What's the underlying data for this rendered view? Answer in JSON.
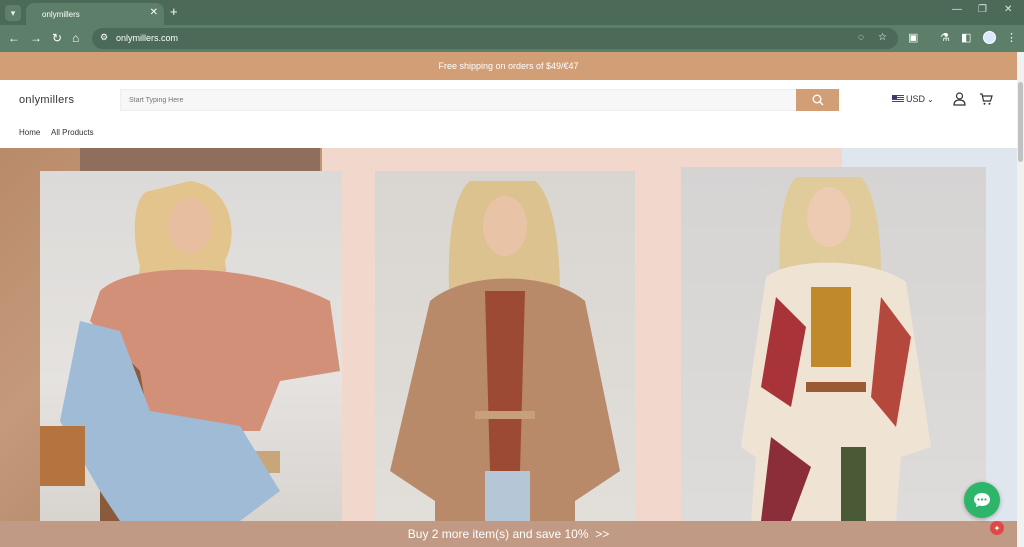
{
  "browser": {
    "tab_title": "onlymillers",
    "tab_close": "✕",
    "new_tab": "+",
    "url": "onlymillers.com",
    "icons": [
      "tab-search-icon",
      "back-icon",
      "forward-icon",
      "reload-icon",
      "home-icon",
      "site-info-icon",
      "eye-off-icon",
      "star-icon",
      "extensions-icon",
      "labs-icon",
      "sidebar-icon",
      "profile-icon",
      "menu-icon",
      "minimize-icon",
      "restore-icon",
      "close-icon"
    ]
  },
  "announcement": {
    "text": "Free shipping on orders of $49/€47"
  },
  "header": {
    "logo": "onlymillers",
    "search_placeholder": "Start Typing Here",
    "currency": "USD",
    "icons": [
      "search-icon",
      "flag-icon",
      "chevron-down-icon",
      "account-icon",
      "cart-icon"
    ]
  },
  "nav": [
    {
      "label": "Home"
    },
    {
      "label": "All Products"
    }
  ],
  "hero": {
    "images": [
      "model-in-peach-lace-blouse",
      "model-in-paisley-quilted-jacket",
      "model-in-floral-cardigan"
    ]
  },
  "promo_bar": {
    "text": "Buy 2 more item(s) and save 10%  >>"
  },
  "widgets": {
    "icons": [
      "chat-icon",
      "gift-icon"
    ]
  },
  "colors": {
    "accent": "#d19e76",
    "browser_dark": "#4b6b58",
    "browser_light": "#5d7f6a",
    "promo": "#c19a85",
    "chat": "#2db56a"
  }
}
